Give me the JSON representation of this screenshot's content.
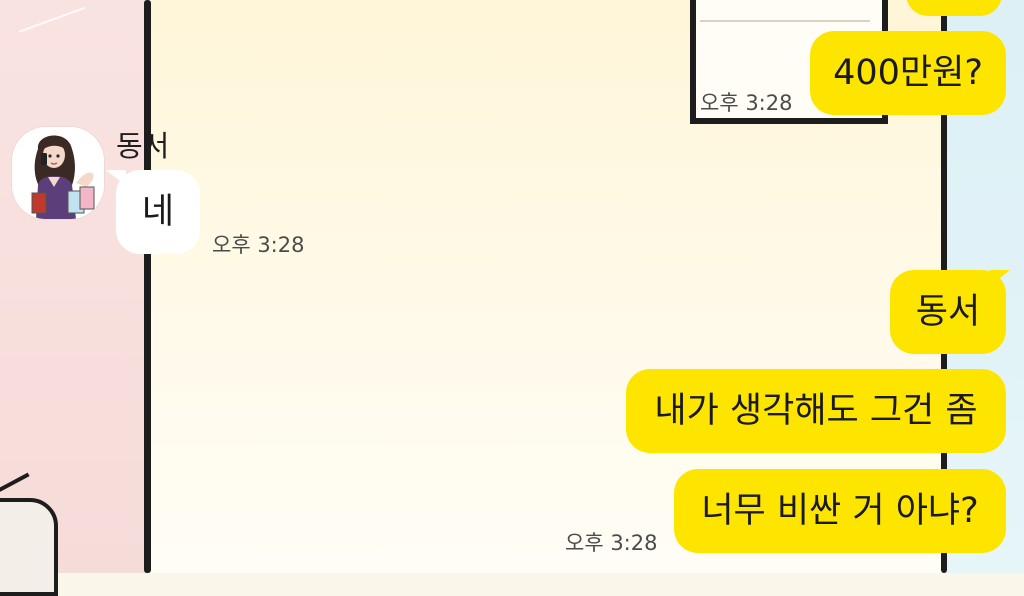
{
  "chat": {
    "top_partial_time": "오후 3:28",
    "top_outgoing": {
      "text": "400만원?"
    },
    "incoming": {
      "sender_name": "동서",
      "text": "네",
      "time": "오후 3:28"
    },
    "outgoing_group": {
      "messages": [
        "동서",
        "내가 생각해도 그건 좀",
        "너무 비싼 거 아냐?"
      ],
      "time": "오후 3:28"
    }
  },
  "colors": {
    "outgoing_bubble": "#fee500",
    "incoming_bubble": "#ffffff",
    "timestamp_text": "#4b4b4b"
  }
}
